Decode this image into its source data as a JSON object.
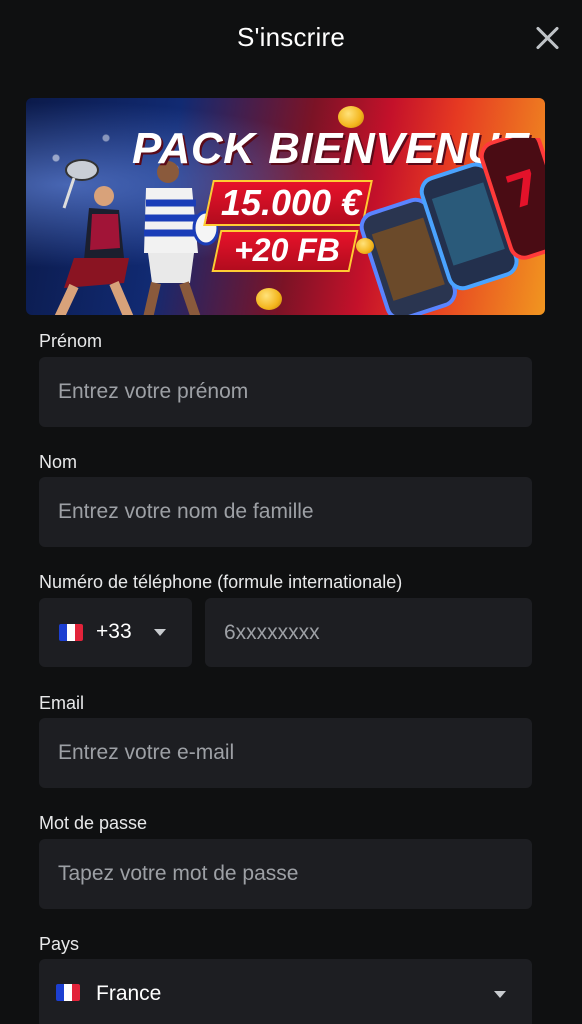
{
  "header": {
    "title": "S'inscrire"
  },
  "banner": {
    "headline": "PACK BIENVENUE",
    "amount": "15.000 €",
    "bonus": "+20 FB"
  },
  "form": {
    "first_name": {
      "label": "Prénom",
      "placeholder": "Entrez votre prénom",
      "value": ""
    },
    "last_name": {
      "label": "Nom",
      "placeholder": "Entrez votre nom de famille",
      "value": ""
    },
    "phone": {
      "label": "Numéro de téléphone (formule internationale)",
      "country_code": "+33",
      "placeholder": "6xxxxxxxx",
      "value": ""
    },
    "email": {
      "label": "Email",
      "placeholder": "Entrez votre e-mail",
      "value": ""
    },
    "password": {
      "label": "Mot de passe",
      "placeholder": "Tapez votre mot de passe",
      "value": ""
    },
    "country": {
      "label": "Pays",
      "value": "France"
    }
  },
  "icons": {
    "close": "close-icon",
    "flag": "france-flag-icon",
    "dropdown": "chevron-down-icon"
  },
  "colors": {
    "background": "#0f1011",
    "field": "#1d1e22",
    "placeholder": "#9da0a5",
    "flag_blue": "#1c3fd1",
    "flag_red": "#e2233a"
  }
}
